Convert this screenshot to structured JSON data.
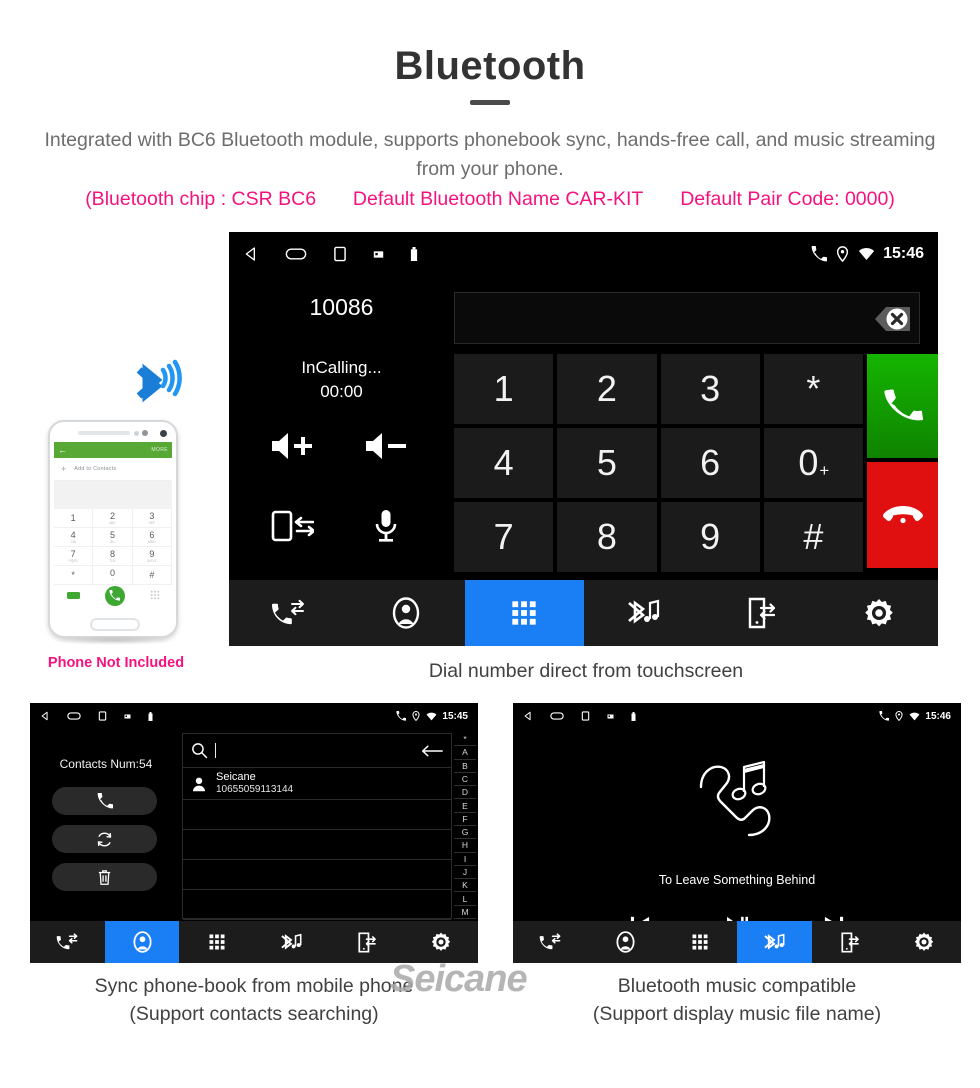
{
  "header": {
    "title": "Bluetooth",
    "subtitle": "Integrated with BC6 Bluetooth module, supports phonebook sync, hands-free call, and music streaming from your phone.",
    "spec_chip": "(Bluetooth chip : CSR BC6",
    "spec_name": "Default Bluetooth Name CAR-KIT",
    "spec_pair": "Default Pair Code: 0000)",
    "accent_pink": "#f5127e",
    "text_gray": "#6d6d6d"
  },
  "captions": {
    "main": "Dial number direct from touchscreen",
    "bottom_left_1": "Sync phone-book from mobile phone",
    "bottom_left_2": "(Support contacts searching)",
    "bottom_right_1": "Bluetooth music compatible",
    "bottom_right_2": "(Support display music file name)",
    "phone_not_included": "Phone Not Included"
  },
  "watermark": "Seicane",
  "dialer_screen": {
    "status": {
      "time": "15:46"
    },
    "called_number": "10086",
    "input_value": "",
    "call_state": "InCalling...",
    "call_timer": "00:00",
    "side_controls": [
      {
        "name": "volume-up",
        "label": "Volume up"
      },
      {
        "name": "volume-down",
        "label": "Volume down"
      },
      {
        "name": "transfer-audio",
        "label": "Transfer to phone"
      },
      {
        "name": "mute-microphone",
        "label": "Mute microphone"
      }
    ],
    "keys": [
      {
        "main": "1",
        "sup": ""
      },
      {
        "main": "2",
        "sup": ""
      },
      {
        "main": "3",
        "sup": ""
      },
      {
        "main": "*",
        "sup": ""
      },
      {
        "main": "4",
        "sup": ""
      },
      {
        "main": "5",
        "sup": ""
      },
      {
        "main": "6",
        "sup": ""
      },
      {
        "main": "0",
        "sup": "+"
      },
      {
        "main": "7",
        "sup": ""
      },
      {
        "main": "8",
        "sup": ""
      },
      {
        "main": "9",
        "sup": ""
      },
      {
        "main": "#",
        "sup": ""
      }
    ],
    "call_button": {
      "name": "answer-call",
      "color": "#14a300"
    },
    "hangup_button": {
      "name": "end-call",
      "color": "#e01010"
    },
    "nav": [
      {
        "name": "call-log",
        "active": false
      },
      {
        "name": "contacts",
        "active": false
      },
      {
        "name": "keypad",
        "active": true
      },
      {
        "name": "bluetooth-music",
        "active": false
      },
      {
        "name": "phone-sync",
        "active": false
      },
      {
        "name": "settings",
        "active": false
      }
    ],
    "nav_active_color": "#1a7ef5"
  },
  "contacts_screen": {
    "status": {
      "time": "15:45"
    },
    "contacts_count_label": "Contacts Num:54",
    "search_value": "",
    "actions": [
      {
        "name": "dial-contact"
      },
      {
        "name": "sync-contacts"
      },
      {
        "name": "delete-contacts"
      }
    ],
    "rows": [
      {
        "name": "Seicane",
        "number": "10655059113144"
      }
    ],
    "index_letters": [
      "*",
      "A",
      "B",
      "C",
      "D",
      "E",
      "F",
      "G",
      "H",
      "I",
      "J",
      "K",
      "L",
      "M"
    ],
    "nav": [
      {
        "name": "call-log",
        "active": false
      },
      {
        "name": "contacts",
        "active": true
      },
      {
        "name": "keypad",
        "active": false
      },
      {
        "name": "bluetooth-music",
        "active": false
      },
      {
        "name": "phone-sync",
        "active": false
      },
      {
        "name": "settings",
        "active": false
      }
    ]
  },
  "music_screen": {
    "status": {
      "time": "15:46"
    },
    "track_title": "To Leave Something Behind",
    "controls": [
      {
        "name": "previous-track"
      },
      {
        "name": "play-pause"
      },
      {
        "name": "next-track"
      }
    ],
    "nav": [
      {
        "name": "call-log",
        "active": false
      },
      {
        "name": "contacts",
        "active": false
      },
      {
        "name": "keypad",
        "active": false
      },
      {
        "name": "bluetooth-music",
        "active": true
      },
      {
        "name": "phone-sync",
        "active": false
      },
      {
        "name": "settings",
        "active": false
      }
    ]
  },
  "phone_illustration": {
    "app_more_label": "MORE",
    "add_to_contacts_label": "Add to Contacts",
    "keys": [
      {
        "d": "1",
        "s": ""
      },
      {
        "d": "2",
        "s": "ABC"
      },
      {
        "d": "3",
        "s": "DEF"
      },
      {
        "d": "4",
        "s": "GHI"
      },
      {
        "d": "5",
        "s": "JKL"
      },
      {
        "d": "6",
        "s": "MNO"
      },
      {
        "d": "7",
        "s": "PQRS"
      },
      {
        "d": "8",
        "s": "TUV"
      },
      {
        "d": "9",
        "s": "WXYZ"
      },
      {
        "d": "*",
        "s": ""
      },
      {
        "d": "0",
        "s": "+"
      },
      {
        "d": "#",
        "s": ""
      }
    ]
  }
}
